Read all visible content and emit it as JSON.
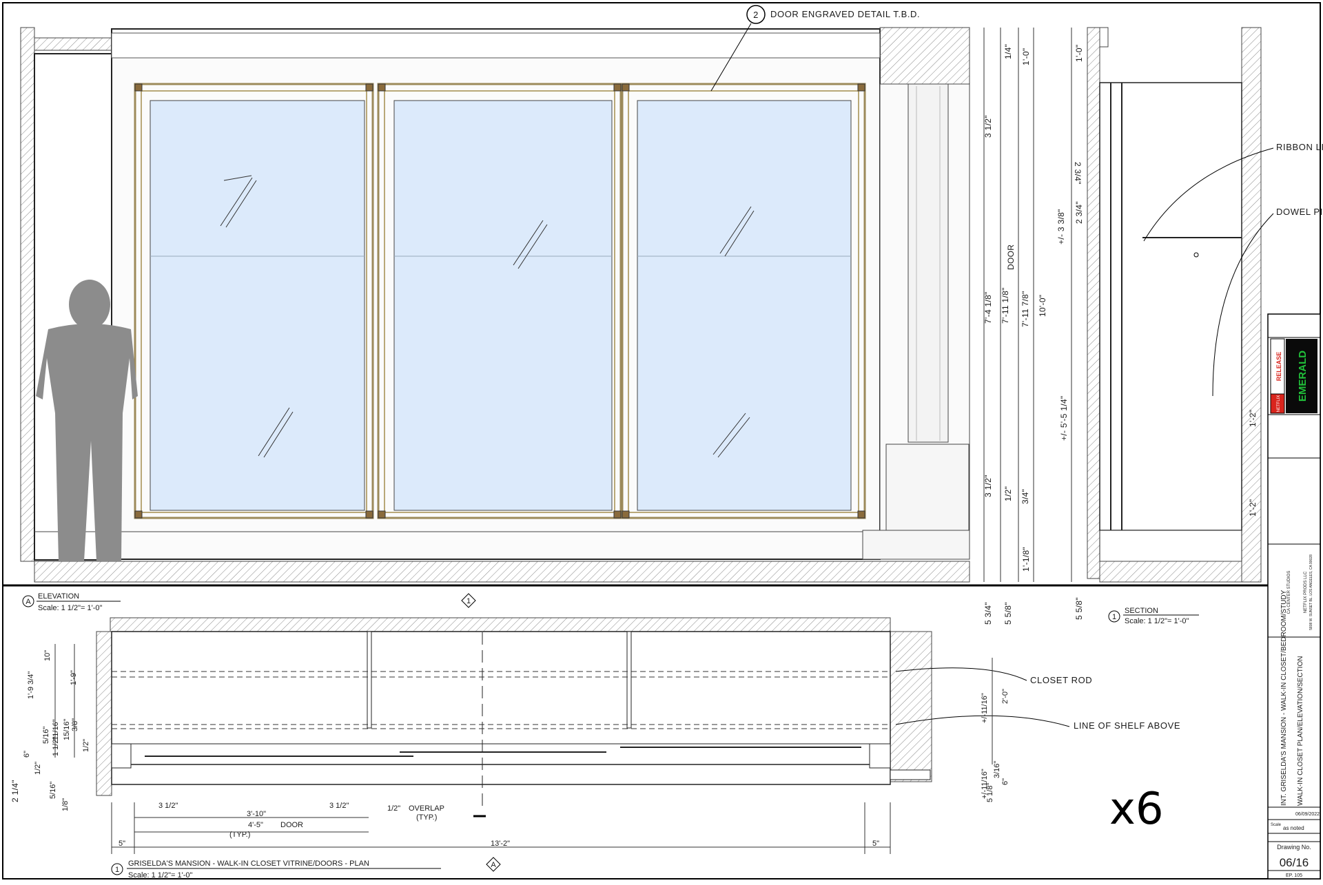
{
  "elevation": {
    "callout_num": "2",
    "callout_text": "DOOR ENGRAVED DETAIL T.B.D.",
    "tag_letter": "A",
    "title": "ELEVATION",
    "scale": "Scale: 1 1/2\"= 1'-0\"",
    "dims": [
      "1/4\"",
      "1'-0\"",
      "3 1/2\"",
      "7'-4 1/8\"",
      "7'-11 1/8\"",
      "DOOR",
      "7'-11 7/8\"",
      "10'-0\"",
      "3 1/2\"",
      "1/2\"",
      "3/4\"",
      "1'-1/8\"",
      "5 3/4\"",
      "5 5/8\""
    ]
  },
  "section": {
    "tag_num": "1",
    "title": "SECTION",
    "scale": "Scale: 1 1/2\"= 1'-0\"",
    "labels": [
      "RIBBON LIGHT",
      "DOWEL PIN"
    ],
    "dims": [
      "1'-0\"",
      "2 3/4\"",
      "+/- 3 3/8\"",
      "2 3/4\"",
      "+/- 5'-5 1/4\"",
      "1'-2\"",
      "1'-2\"",
      "5 5/8\""
    ]
  },
  "plan": {
    "tag_num": "1",
    "title": "GRISELDA'S MANSION - WALK-IN CLOSET VITRINE/DOORS - PLAN",
    "scale": "Scale: 1 1/2\"= 1'-0\"",
    "marker_top": "1",
    "marker_bottom": "A",
    "labels": [
      "CLOSET ROD",
      "LINE OF SHELF ABOVE",
      "OVERLAP",
      "(TYP.)",
      "DOOR",
      "(TYP.)"
    ],
    "dims": [
      "10\"",
      "1'-9 3/4\"",
      "1'-9\"",
      "11/16\"",
      "15/16\"",
      "3/8\"",
      "5/16\"",
      "1 1/2\"",
      "1/2\"",
      "6\"",
      "1/2\"",
      "5/16\"",
      "1/8\"",
      "2 1/4\"",
      "3 1/2\"",
      "3'-10\"",
      "3 1/2\"",
      "1/2\"",
      "4'-5\"",
      "5\"",
      "13'-2\"",
      "5\"",
      "+/-11/16\"",
      "2'-0\"",
      "+/-11/16\"",
      "3/16\"",
      "5 1/8\"",
      "6\""
    ],
    "multiplier": "x6"
  },
  "title_block": {
    "release": "RELEASE",
    "studio": "NETFLIX",
    "show": "EMERALD",
    "company": "NETFLIX PRODS LLC",
    "address": "5808 W. SUNSET BL. LOS ANGELES, CA 90028",
    "stage": "CA CENTER STUDIOS",
    "project_title": "INT. GRISELDA'S MANSION - WALK-IN CLOSET/BEDROOM/STUDY",
    "sheet_title": "WALK-IN CLOSET PLAN/ELEVATION/SECTION",
    "date": "06/09/2022",
    "scale_label": "Scale",
    "scale_value": "as noted",
    "drawing_no_label": "Drawing No.",
    "drawing_no": "06/16",
    "ep": "EP. 105"
  },
  "colors": {
    "glass": "#dceafb",
    "frame": "#9c8a5a",
    "silhouette": "#8c8c8c",
    "release": "#d9241c",
    "show": "#21c23a"
  }
}
